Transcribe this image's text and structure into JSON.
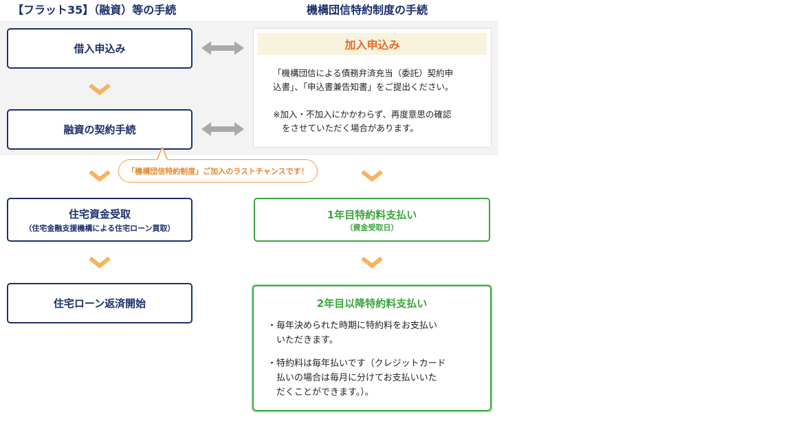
{
  "headers": {
    "left": "【フラット35】（融資）等の手続",
    "right": "機構団信特約制度の手続"
  },
  "left_steps": [
    {
      "label": "借入申込み"
    },
    {
      "label": "融資の契約手続"
    },
    {
      "label": "住宅資金受取",
      "sub": "（住宅金融支援機構による住宅ローン買取）"
    },
    {
      "label": "住宅ローン返済開始"
    }
  ],
  "application_panel": {
    "title": "加入申込み",
    "line1": "「機構団信による債務弁済充当（委託）契約申",
    "line2": "込書」、「申込書兼告知書」をご提出ください。",
    "note1": "※加入・不加入にかかわらず、再度意思の確認",
    "note2": "をさせていただく場合があります。"
  },
  "callout": "「機構団信特約制度」ご加入のラストチャンスです！",
  "first_year": {
    "title": "1年目特約料支払い",
    "sub": "（資金受取日）"
  },
  "second_year": {
    "title": "2年目以降特約料支払い",
    "b1_l1": "・毎年決められた時期に特約料をお支払い",
    "b1_l2": "いただきます。",
    "b2_l1": "・特約料は毎年払いです（クレジットカード",
    "b2_l2": "払いの場合は毎月に分けてお支払いいた",
    "b2_l3": "だくことができます。）。"
  },
  "colors": {
    "navy": "#1b2f6b",
    "green": "#3aa53a",
    "orange_title": "#e8692a",
    "chevron": "#f5b462",
    "arrow_grey": "#a9a9a9",
    "panel_bg": "#f3f3f3",
    "title_band": "#f8f3dc"
  }
}
